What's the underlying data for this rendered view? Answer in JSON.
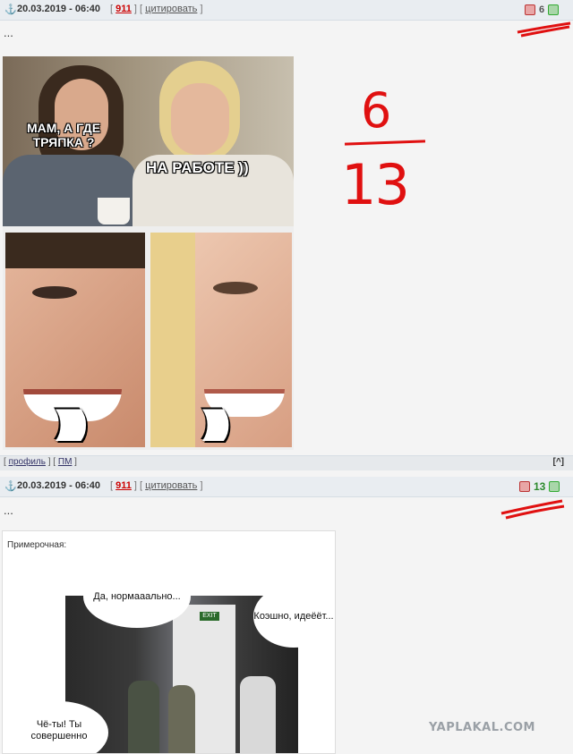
{
  "post1": {
    "date": "20.03.2019 - 06:40",
    "number": "911",
    "quote_label": "цитировать",
    "score": "6",
    "body_text": "..."
  },
  "meme": {
    "bubble_left": "МАМ, А ГДЕ ТРЯПКА ?",
    "bubble_right": "НА РАБОТЕ ))",
    "smile_left": "))))))",
    "smile_right": ")))))"
  },
  "annotation": {
    "numerator": "6",
    "denominator": "13",
    "color": "#e01010"
  },
  "footer": {
    "profile_label": "профиль",
    "pm_label": "ПМ",
    "up_label": "[^]"
  },
  "post2": {
    "date": "20.03.2019 - 06:40",
    "number": "911",
    "quote_label": "цитировать",
    "score": "13",
    "body_text": "..."
  },
  "comic": {
    "caption": "Примерочная:",
    "bubble1": "Да, нормааально...",
    "bubble2": "Коэшно, идеёёт...",
    "bubble3": "Чё-ты! Ты совершенно",
    "exit_sign": "EXIT"
  },
  "watermark": "YAPLAKAL.COM"
}
